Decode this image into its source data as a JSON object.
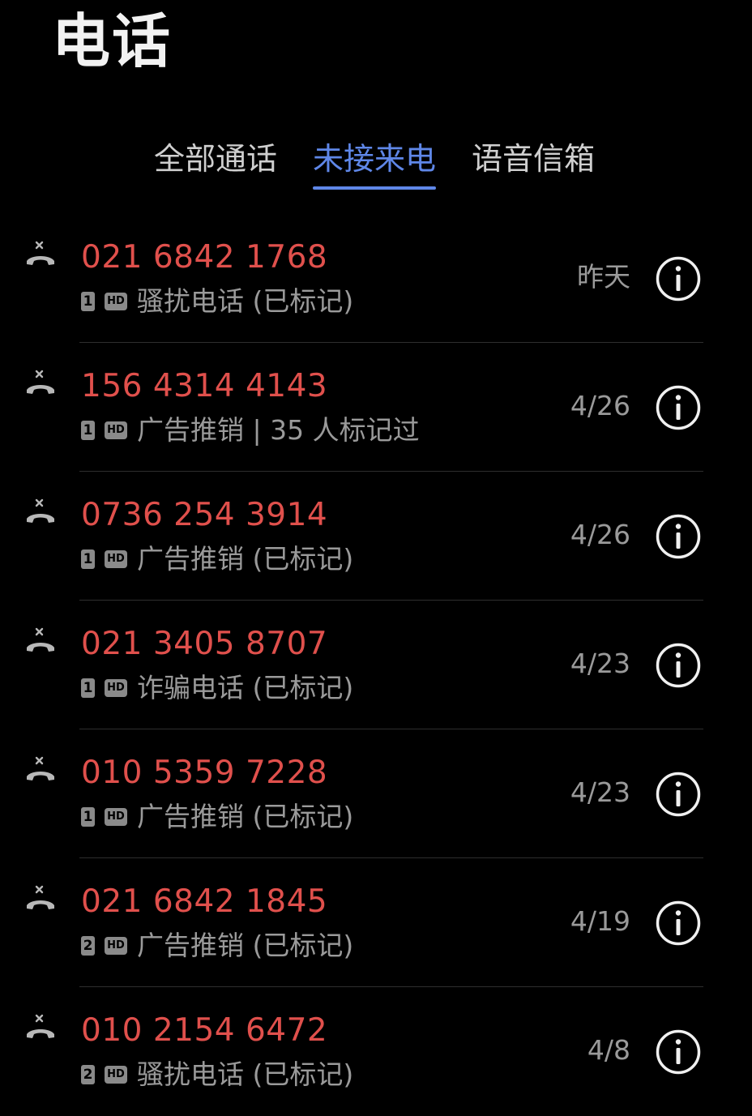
{
  "app": {
    "title": "电话"
  },
  "tabs": [
    {
      "label": "全部通话",
      "active": false
    },
    {
      "label": "未接来电",
      "active": true
    },
    {
      "label": "语音信箱",
      "active": false
    }
  ],
  "colors": {
    "background": "#000000",
    "missed_number": "#e0504c",
    "accent": "#5f87e8",
    "secondary_text": "#9a9a9a"
  },
  "icons": {
    "call_type": "missed-call-icon",
    "sim": "sim-card-icon",
    "hd": "hd-voice-icon",
    "details": "info-icon"
  },
  "calls": [
    {
      "number": "021 6842 1768",
      "sim": "1",
      "hd": "HD",
      "label": "骚扰电话 (已标记)",
      "date": "昨天"
    },
    {
      "number": "156 4314 4143",
      "sim": "1",
      "hd": "HD",
      "label": "广告推销 | 35 人标记过",
      "date": "4/26"
    },
    {
      "number": "0736 254 3914",
      "sim": "1",
      "hd": "HD",
      "label": "广告推销 (已标记)",
      "date": "4/26"
    },
    {
      "number": "021 3405 8707",
      "sim": "1",
      "hd": "HD",
      "label": "诈骗电话 (已标记)",
      "date": "4/23"
    },
    {
      "number": "010 5359 7228",
      "sim": "1",
      "hd": "HD",
      "label": "广告推销 (已标记)",
      "date": "4/23"
    },
    {
      "number": "021 6842 1845",
      "sim": "2",
      "hd": "HD",
      "label": "广告推销 (已标记)",
      "date": "4/19"
    },
    {
      "number": "010 2154 6472",
      "sim": "2",
      "hd": "HD",
      "label": "骚扰电话 (已标记)",
      "date": "4/8"
    }
  ]
}
